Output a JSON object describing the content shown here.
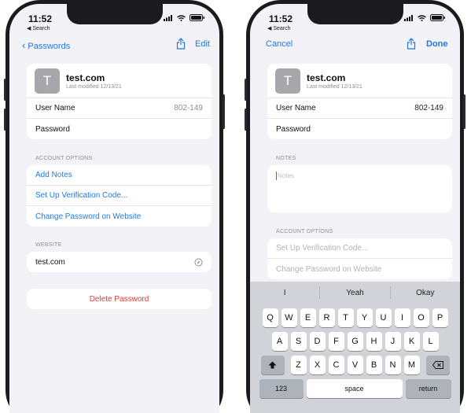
{
  "status": {
    "time": "11:52",
    "back_label": "◀ Search"
  },
  "left": {
    "nav": {
      "back_label": "Passwords",
      "edit_label": "Edit"
    },
    "site": {
      "avatar_letter": "T",
      "title": "test.com",
      "subtitle": "Last modified 12/13/21"
    },
    "fields": [
      {
        "label": "User Name",
        "value": "802-149"
      },
      {
        "label": "Password",
        "value": ""
      }
    ],
    "account_options": {
      "header": "ACCOUNT OPTIONS",
      "items": [
        "Add Notes",
        "Set Up Verification Code...",
        "Change Password on Website"
      ]
    },
    "website": {
      "header": "WEBSITE",
      "value": "test.com"
    },
    "delete_label": "Delete Password"
  },
  "right": {
    "nav": {
      "cancel_label": "Cancel",
      "done_label": "Done"
    },
    "site": {
      "avatar_letter": "T",
      "title": "test.com",
      "subtitle": "Last modified 12/13/21"
    },
    "fields": [
      {
        "label": "User Name",
        "value": "802-149"
      },
      {
        "label": "Password",
        "value": ""
      }
    ],
    "notes": {
      "header": "NOTES",
      "placeholder": "Notes"
    },
    "account_options": {
      "header": "ACCOUNT OPTIONS",
      "items": [
        "Set Up Verification Code...",
        "Change Password on Website"
      ]
    },
    "keyboard": {
      "suggestions": [
        "I",
        "Yeah",
        "Okay"
      ],
      "row1": [
        "Q",
        "W",
        "E",
        "R",
        "T",
        "Y",
        "U",
        "I",
        "O",
        "P"
      ],
      "row2": [
        "A",
        "S",
        "D",
        "F",
        "G",
        "H",
        "J",
        "K",
        "L"
      ],
      "row3": [
        "Z",
        "X",
        "C",
        "V",
        "B",
        "N",
        "M"
      ],
      "numbers_label": "123",
      "space_label": "space",
      "return_label": "return"
    }
  },
  "colors": {
    "accent": "#1f7ae0",
    "destructive": "#e5372c",
    "background": "#f2f2f7"
  }
}
